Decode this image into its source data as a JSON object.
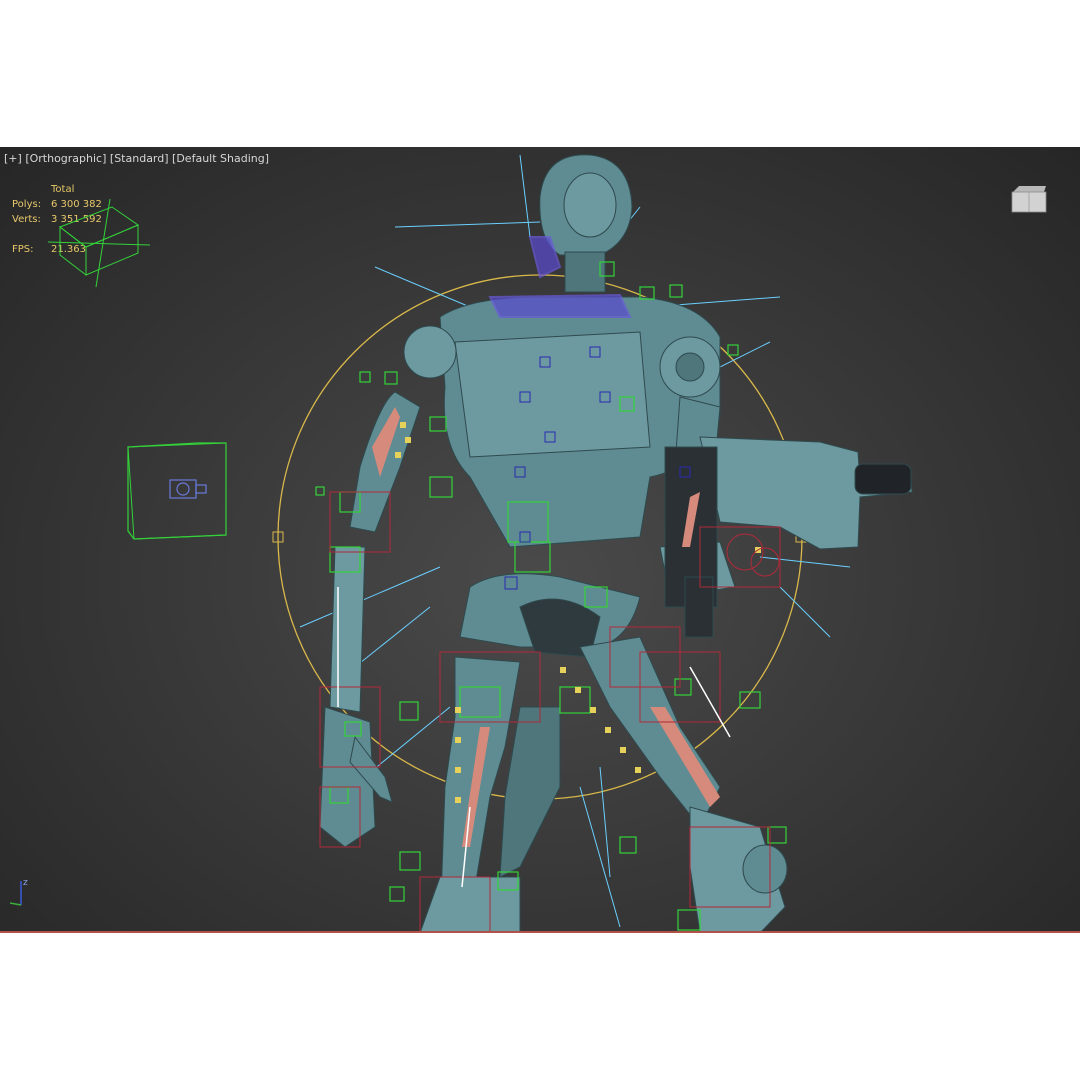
{
  "viewport": {
    "label_plus": "[+]",
    "label_view": "[Orthographic]",
    "label_mode": "[Standard]",
    "label_shading": "[Default Shading]",
    "stats": {
      "header": "Total",
      "polys_label": "Polys:",
      "polys_value": "6 300 382",
      "verts_label": "Verts:",
      "verts_value": "3 351 592",
      "fps_label": "FPS:",
      "fps_value": "21.363"
    },
    "axis_label": "z",
    "colors": {
      "background": "#3a3a3a",
      "mesh": "#5f8c92",
      "bone_helper": "#34d23a",
      "wire_red": "#b02a3a",
      "wire_blue": "#6ad0ff",
      "stats_text": "#e8c86a",
      "circle": "#d9b84a"
    },
    "icons": [
      "viewcube-icon",
      "camera-icon",
      "axis-tripod-icon"
    ]
  }
}
